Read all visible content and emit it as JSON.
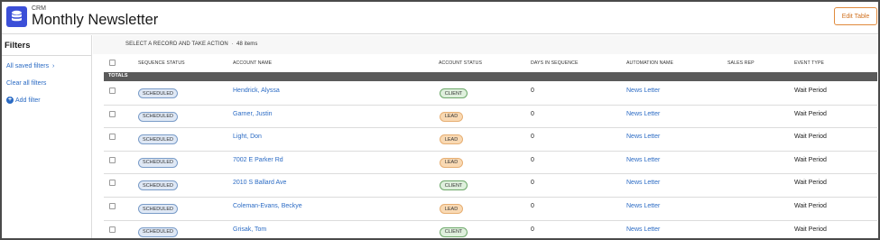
{
  "header": {
    "app_label": "CRM",
    "title": "Monthly Newsletter",
    "edit_button": "Edit Table"
  },
  "sidebar": {
    "title": "Filters",
    "saved_filters": "All saved filters",
    "clear_filters": "Clear all filters",
    "add_filter": "Add filter"
  },
  "action_bar": {
    "text": "SELECT A RECORD AND TAKE ACTION",
    "count": "48 items"
  },
  "columns": [
    "SEQUENCE STATUS",
    "ACCOUNT NAME",
    "ACCOUNT STATUS",
    "DAYS IN SEQUENCE",
    "AUTOMATION NAME",
    "SALES REP",
    "EVENT TYPE"
  ],
  "totals_label": "TOTALS",
  "rows": [
    {
      "sequence_status": "SCHEDULED",
      "account_name": "Hendrick, Alyssa",
      "account_status": "CLIENT",
      "days": "0",
      "automation": "News Letter",
      "sales_rep": "",
      "event_type": "Wait Period"
    },
    {
      "sequence_status": "SCHEDULED",
      "account_name": "Garner, Justin",
      "account_status": "LEAD",
      "days": "0",
      "automation": "News Letter",
      "sales_rep": "",
      "event_type": "Wait Period"
    },
    {
      "sequence_status": "SCHEDULED",
      "account_name": "Light, Don",
      "account_status": "LEAD",
      "days": "0",
      "automation": "News Letter",
      "sales_rep": "",
      "event_type": "Wait Period"
    },
    {
      "sequence_status": "SCHEDULED",
      "account_name": "7002 E Parker Rd",
      "account_status": "LEAD",
      "days": "0",
      "automation": "News Letter",
      "sales_rep": "",
      "event_type": "Wait Period"
    },
    {
      "sequence_status": "SCHEDULED",
      "account_name": "2010 S Ballard Ave",
      "account_status": "CLIENT",
      "days": "0",
      "automation": "News Letter",
      "sales_rep": "",
      "event_type": "Wait Period"
    },
    {
      "sequence_status": "SCHEDULED",
      "account_name": "Coleman-Evans, Beckye",
      "account_status": "LEAD",
      "days": "0",
      "automation": "News Letter",
      "sales_rep": "",
      "event_type": "Wait Period"
    },
    {
      "sequence_status": "SCHEDULED",
      "account_name": "Grisak, Tom",
      "account_status": "CLIENT",
      "days": "0",
      "automation": "News Letter",
      "sales_rep": "",
      "event_type": "Wait Period"
    }
  ],
  "icons": {
    "app": "database-icon",
    "add_filter": "plus-circle-icon",
    "saved_filters_chevron": "chevron-right-icon"
  },
  "colors": {
    "accent": "#2b6bc4",
    "app_icon": "#3b4fd8",
    "edit_button": "#e08a3c",
    "client_badge": "#dff0dd",
    "lead_badge": "#f9d9b3",
    "scheduled_badge": "#dfe8f5"
  }
}
